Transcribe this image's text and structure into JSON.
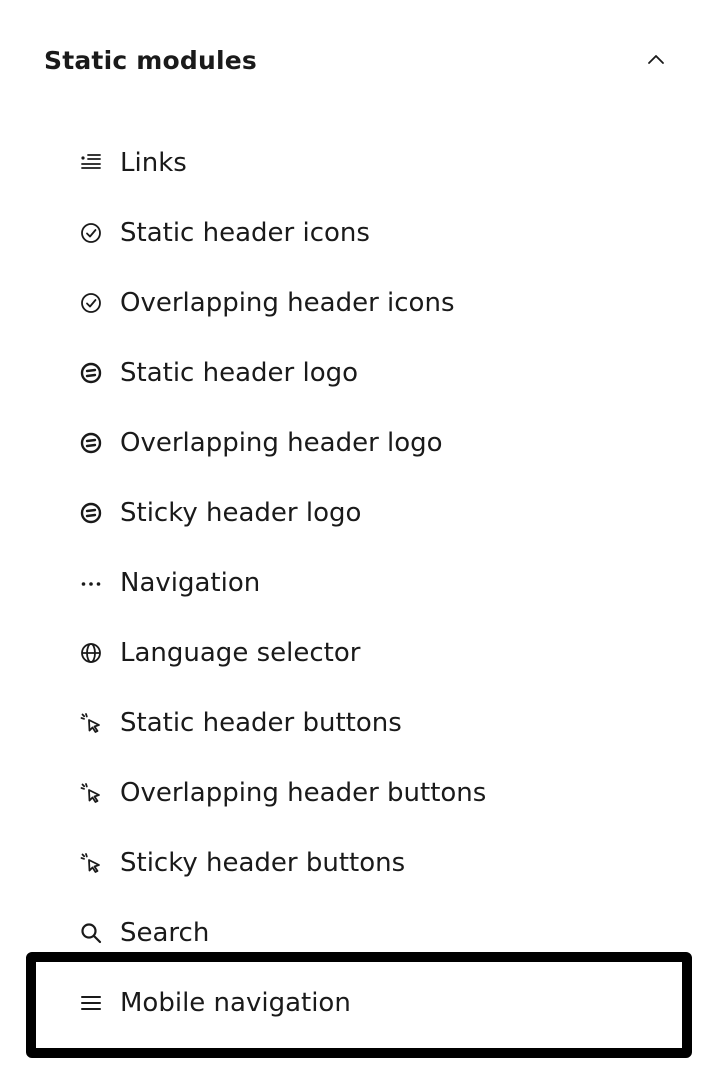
{
  "section": {
    "title": "Static modules",
    "expanded_icon": "chevron-up-icon"
  },
  "modules": [
    {
      "label": "Links",
      "icon": "links-list-icon"
    },
    {
      "label": "Static header icons",
      "icon": "check-circle-icon"
    },
    {
      "label": "Overlapping header icons",
      "icon": "check-circle-icon"
    },
    {
      "label": "Static header logo",
      "icon": "logo-icon"
    },
    {
      "label": "Overlapping header logo",
      "icon": "logo-icon"
    },
    {
      "label": "Sticky header logo",
      "icon": "logo-icon"
    },
    {
      "label": "Navigation",
      "icon": "ellipsis-icon"
    },
    {
      "label": "Language selector",
      "icon": "globe-icon"
    },
    {
      "label": "Static header buttons",
      "icon": "cursor-click-icon"
    },
    {
      "label": "Overlapping header buttons",
      "icon": "cursor-click-icon"
    },
    {
      "label": "Sticky header buttons",
      "icon": "cursor-click-icon"
    },
    {
      "label": "Search",
      "icon": "search-icon"
    },
    {
      "label": "Mobile navigation",
      "icon": "hamburger-menu-icon"
    }
  ],
  "selected_index": 12,
  "colors": {
    "text": "#1a1a1a",
    "highlight_border": "#000000",
    "background": "#ffffff"
  }
}
